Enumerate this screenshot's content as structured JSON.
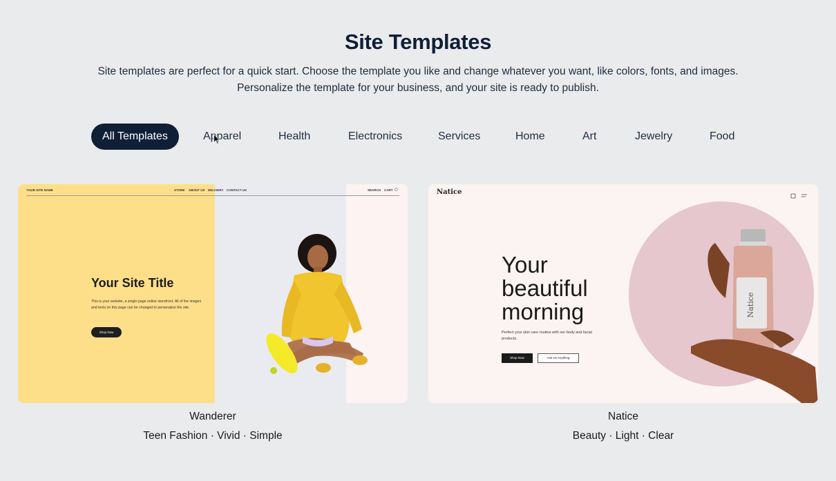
{
  "header": {
    "title": "Site Templates",
    "intro_line1": "Site templates are perfect for a quick start. Choose the template you like and change whatever you want, like colors, fonts, and images.",
    "intro_line2": "Personalize the template for your business, and your site is ready to publish."
  },
  "categories": [
    {
      "label": "All Templates",
      "active": true
    },
    {
      "label": "Apparel",
      "active": false
    },
    {
      "label": "Health",
      "active": false
    },
    {
      "label": "Electronics",
      "active": false
    },
    {
      "label": "Services",
      "active": false
    },
    {
      "label": "Home",
      "active": false
    },
    {
      "label": "Art",
      "active": false
    },
    {
      "label": "Jewelry",
      "active": false
    },
    {
      "label": "Food",
      "active": false
    }
  ],
  "templates": [
    {
      "name": "Wanderer",
      "tags": "Teen Fashion · Vivid · Simple",
      "preview": {
        "site_name": "YOUR SITE NAME",
        "nav": [
          "STORE",
          "ABOUT US",
          "DELIVERY",
          "CONTACT US"
        ],
        "nav_right": [
          "SEARCH",
          "CART"
        ],
        "title": "Your Site Title",
        "description": "This is your website, a single-page online storefront. All of the images and texts on this page can be changed to personalize the site.",
        "button": "Shop Now",
        "accent": "#fddf8a"
      }
    },
    {
      "name": "Natice",
      "tags": "Beauty · Light · Clear",
      "preview": {
        "logo": "Natice",
        "headline": [
          "Your",
          "beautiful",
          "morning"
        ],
        "subtitle": "Perfect your skin care routine with our body and facial products.",
        "button_primary": "Shop Now",
        "button_secondary": "Ask Us Anything",
        "bottle_label": "Natice",
        "accent": "#e5c7cd"
      }
    }
  ]
}
